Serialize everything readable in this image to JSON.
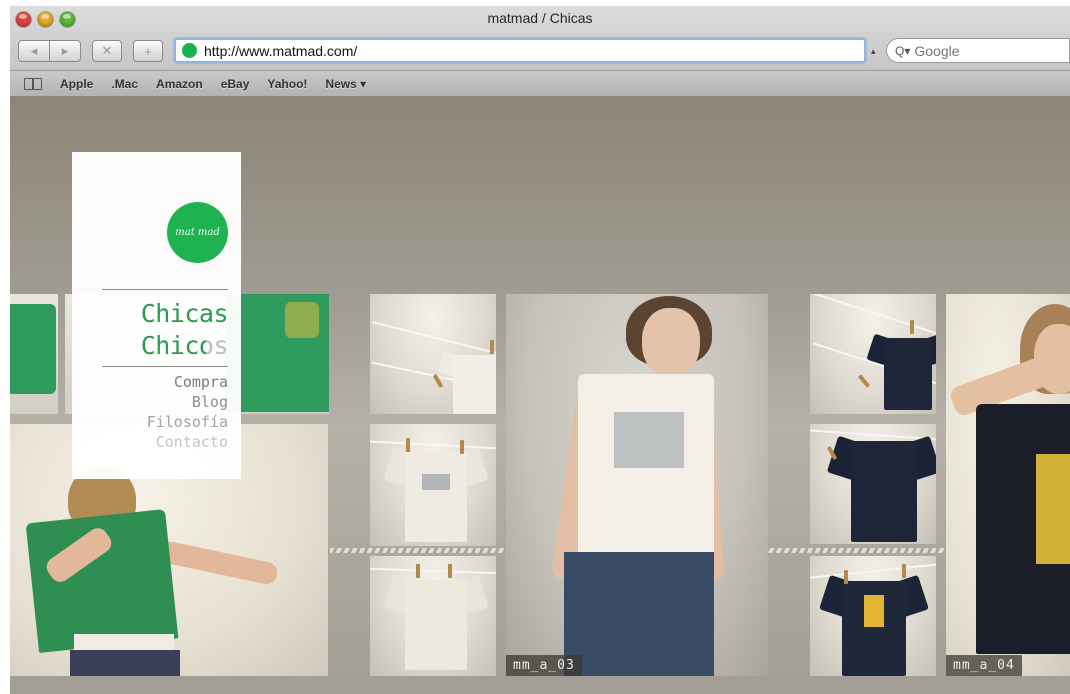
{
  "window": {
    "title": "matmad / Chicas"
  },
  "toolbar": {
    "back_glyph": "◂",
    "forward_glyph": "▸",
    "stop_glyph": "✕",
    "add_glyph": "+",
    "url": "http://www.matmad.com/",
    "search_placeholder": "Google",
    "search_glyph": "Q▾"
  },
  "bookmarks": [
    "Apple",
    ".Mac",
    "Amazon",
    "eBay",
    "Yahoo!",
    "News ▾"
  ],
  "nav": {
    "logo_text": "mat mad",
    "primary": [
      "Chicas",
      "Chicos"
    ],
    "secondary": [
      "Compra",
      "Blog",
      "Filosofía",
      "Contacto"
    ]
  },
  "photos": {
    "label_center": "mm_a_03",
    "label_right": "mm_a_04"
  },
  "colors": {
    "brand_green": "#1eb350",
    "nav_text_green": "#2a9a4b",
    "url_bar_focus": "#8fb5e0"
  }
}
